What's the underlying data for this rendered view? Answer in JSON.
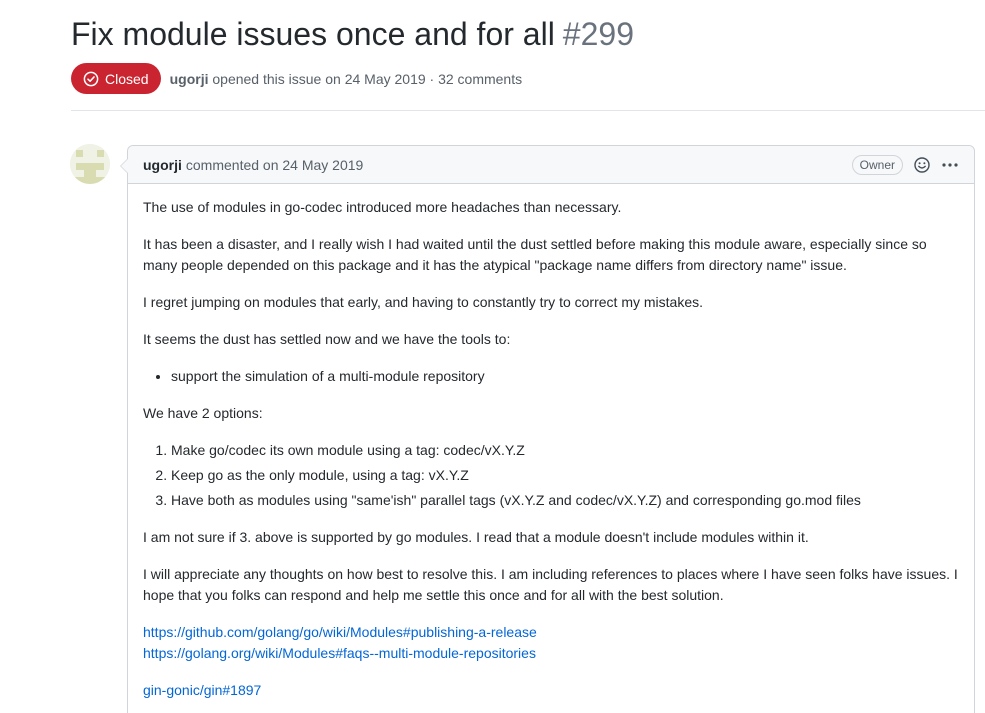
{
  "issue": {
    "title": "Fix module issues once and for all",
    "number": "#299",
    "state_label": "Closed",
    "author": "ugorji",
    "meta_suffix": "opened this issue on 24 May 2019 · 32 comments"
  },
  "icons": {
    "state": "closed-circle-icon",
    "avatar": "identicon-avatar",
    "reaction": "smiley-icon",
    "more": "kebab-horizontal-icon"
  },
  "comment": {
    "author": "ugorji",
    "action_date": "commented on 24 May 2019",
    "role_badge": "Owner",
    "paragraphs": [
      "The use of modules in go-codec introduced more headaches than necessary.",
      "It has been a disaster, and I really wish I had waited until the dust settled before making this module aware, especially since so many people depended on this package and it has the atypical \"package name differs from directory name\" issue.",
      "I regret jumping on modules that early, and having to constantly try to correct my mistakes.",
      "It seems the dust has settled now and we have the tools to:"
    ],
    "bullets": [
      "support the simulation of a multi-module repository"
    ],
    "options_intro": "We have 2 options:",
    "options": [
      "Make go/codec its own module using a tag: codec/vX.Y.Z",
      "Keep go as the only module, using a tag: vX.Y.Z",
      "Have both as modules using \"same'ish\" parallel tags (vX.Y.Z and codec/vX.Y.Z) and corresponding go.mod files"
    ],
    "after_options": [
      "I am not sure if 3. above is supported by go modules. I read that a module doesn't include modules within it.",
      "I will appreciate any thoughts on how best to resolve this. I am including references to places where I have seen folks have issues. I hope that you folks can respond and help me settle this once and for all with the best solution."
    ],
    "links": [
      "https://github.com/golang/go/wiki/Modules#publishing-a-release",
      "https://golang.org/wiki/Modules#faqs--multi-module-repositories"
    ],
    "ref_link": "gin-gonic/gin#1897"
  },
  "colors": {
    "closed": "#cb2431",
    "link": "#0366d6",
    "muted": "#586069"
  }
}
